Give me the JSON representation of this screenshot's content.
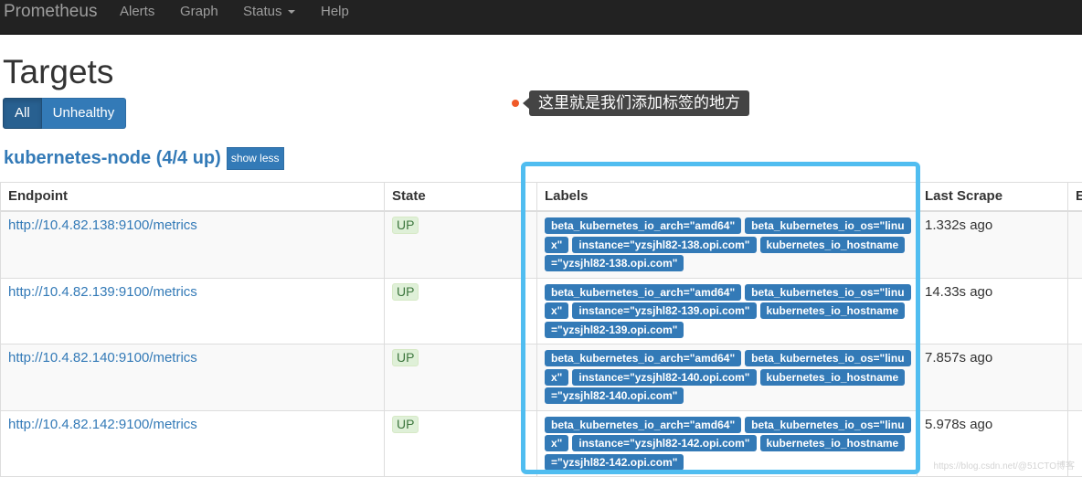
{
  "navbar": {
    "brand": "Prometheus",
    "items": [
      "Alerts",
      "Graph",
      "Status",
      "Help"
    ]
  },
  "page": {
    "title": "Targets",
    "filters": {
      "all": "All",
      "unhealthy": "Unhealthy"
    }
  },
  "callout": {
    "text": "这里就是我们添加标签的地方",
    "dot_color": "#f05a28"
  },
  "job": {
    "title": "kubernetes-node (4/4 up)",
    "toggle_label": "show less"
  },
  "table": {
    "headers": [
      "Endpoint",
      "State",
      "Labels",
      "Last Scrape",
      "Error"
    ],
    "headers_visible": [
      "Endpoint",
      "State",
      "Labels",
      "Last Scrape",
      "E"
    ],
    "rows": [
      {
        "endpoint": "http://10.4.82.138:9100/metrics",
        "state": "UP",
        "labels": [
          "beta_kubernetes_io_arch=\"amd64\"",
          "beta_kubernetes_io_os=\"linux\"",
          "instance=\"yzsjhl82-138.opi.com\"",
          "kubernetes_io_hostname=\"yzsjhl82-138.opi.com\""
        ],
        "last_scrape": "1.332s ago"
      },
      {
        "endpoint": "http://10.4.82.139:9100/metrics",
        "state": "UP",
        "labels": [
          "beta_kubernetes_io_arch=\"amd64\"",
          "beta_kubernetes_io_os=\"linux\"",
          "instance=\"yzsjhl82-139.opi.com\"",
          "kubernetes_io_hostname=\"yzsjhl82-139.opi.com\""
        ],
        "last_scrape": "14.33s ago"
      },
      {
        "endpoint": "http://10.4.82.140:9100/metrics",
        "state": "UP",
        "labels": [
          "beta_kubernetes_io_arch=\"amd64\"",
          "beta_kubernetes_io_os=\"linux\"",
          "instance=\"yzsjhl82-140.opi.com\"",
          "kubernetes_io_hostname=\"yzsjhl82-140.opi.com\""
        ],
        "last_scrape": "7.857s ago"
      },
      {
        "endpoint": "http://10.4.82.142:9100/metrics",
        "state": "UP",
        "labels": [
          "beta_kubernetes_io_arch=\"amd64\"",
          "beta_kubernetes_io_os=\"linux\"",
          "instance=\"yzsjhl82-142.opi.com\"",
          "kubernetes_io_hostname=\"yzsjhl82-142.opi.com\""
        ],
        "last_scrape": "5.978s ago"
      }
    ]
  },
  "colors": {
    "accent": "#337ab7",
    "highlight": "#50bdf0",
    "up_bg": "#dff0d8",
    "up_text": "#3c763d"
  },
  "watermark": "https://blog.csdn.net/@51CTO博客"
}
